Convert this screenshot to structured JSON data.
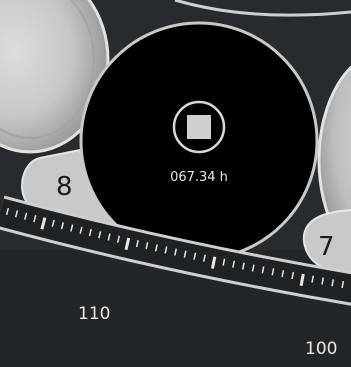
{
  "instrument": {
    "slots": [
      {
        "label": "8",
        "state": "empty"
      },
      {
        "label": "7",
        "state": "empty"
      }
    ],
    "active_slot": {
      "button_icon": "stop-icon",
      "elapsed_time": "067.34 h"
    },
    "scale_labels": [
      "110",
      "100"
    ]
  },
  "colors": {
    "background": "#272b2d",
    "active_disc": "#000000",
    "slot_fill": "#c9c9c9",
    "slot_border": "#e6e6e6",
    "scale_ring": "#222426",
    "tick": "#e9e9e9",
    "text_light": "#e8e8e8",
    "text_dark": "#1b1b1b"
  }
}
